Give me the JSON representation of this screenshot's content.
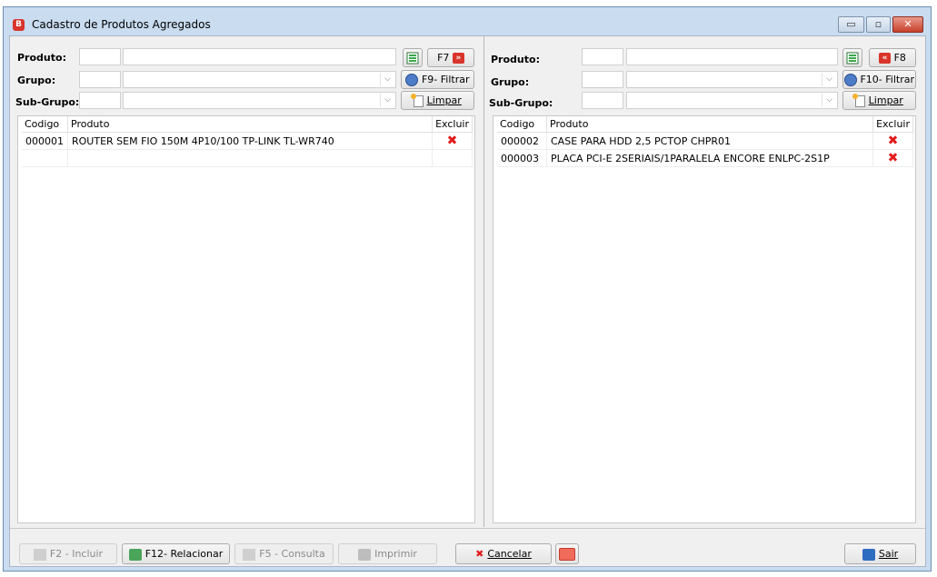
{
  "window": {
    "title": "Cadastro de Produtos Agregados",
    "app_icon_letter": "B",
    "minimize": "▭",
    "maximize": "▫",
    "close": "✕"
  },
  "left": {
    "produto_label": "Produto:",
    "grupo_label": "Grupo:",
    "subgrupo_label": "Sub-Grupo:",
    "f7_label": "F7",
    "filtrar_label": "F9- Filtrar",
    "limpar_label": "Limpar",
    "columns": [
      "Codigo",
      "Produto",
      "Excluir"
    ],
    "rows": [
      {
        "codigo": "000001",
        "produto": "ROUTER SEM FIO 150M 4P10/100 TP-LINK TL-WR740"
      }
    ]
  },
  "right": {
    "produto_label": "Produto:",
    "grupo_label": "Grupo:",
    "subgrupo_label": "Sub-Grupo:",
    "f8_label": "F8",
    "filtrar_label": "F10- Filtrar",
    "limpar_label": "Limpar",
    "columns": [
      "Codigo",
      "Produto",
      "Excluir"
    ],
    "rows": [
      {
        "codigo": "000002",
        "produto": "CASE PARA HDD 2,5 PCTOP CHPR01"
      },
      {
        "codigo": "000003",
        "produto": "PLACA PCI-E 2SERIAIS/1PARALELA ENCORE ENLPC-2S1P"
      }
    ]
  },
  "footer": {
    "incluir": "F2 - Incluir",
    "relacionar": "F12- Relacionar",
    "consulta": "F5 - Consulta",
    "imprimir": "Imprimir",
    "cancelar": "Cancelar",
    "sair": "Sair"
  },
  "icons": {
    "delete": "✖",
    "arrow_right": "»",
    "arrow_left": "«",
    "combo": "⌵"
  },
  "colors": {
    "accent_red": "#d9342b",
    "title_bar": "#c9dcf0"
  }
}
